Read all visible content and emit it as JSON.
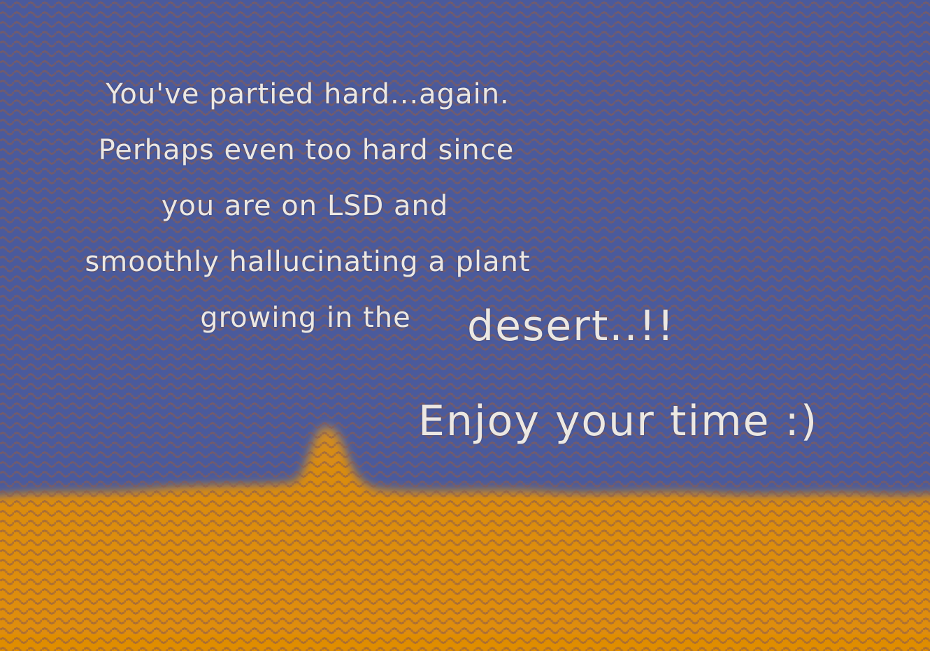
{
  "story": {
    "line1": "You've partied hard...again.",
    "line2": "Perhaps even too hard since",
    "line3": "you are on LSD and",
    "line4": "smoothly hallucinating a plant",
    "line5": "growing in the",
    "emphasis": "desert..!!",
    "closing": "Enjoy your time :)"
  },
  "colors": {
    "sky": "#4a5a9c",
    "sand": "#de8c06",
    "dot_pattern": "#8a5a4e",
    "text": "#ece8e2"
  }
}
